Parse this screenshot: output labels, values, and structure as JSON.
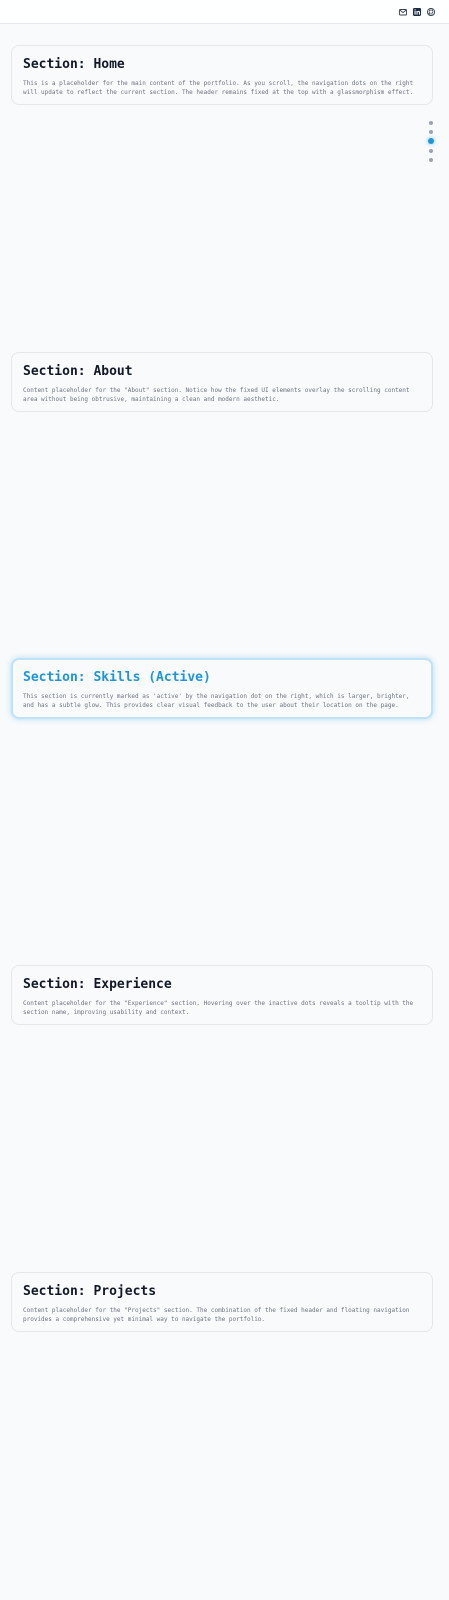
{
  "header": {
    "icons": [
      "mail-icon",
      "linkedin-icon",
      "github-icon"
    ]
  },
  "sections": [
    {
      "title": "Section: Home",
      "body": "This is a placeholder for the main content of the portfolio. As you scroll, the navigation dots on the right will update to reflect the current section. The header remains fixed at the top with a glassmorphism effect."
    },
    {
      "title": "Section: About",
      "body": "Content placeholder for the \"About\" section. Notice how the fixed UI elements overlay the scrolling content area without being obtrusive, maintaining a clean and modern aesthetic."
    },
    {
      "title": "Section: Skills (Active)",
      "body": "This section is currently marked as 'active' by the navigation dot on the right, which is larger, brighter, and has a subtle glow. This provides clear visual feedback to the user about their location on the page."
    },
    {
      "title": "Section: Experience",
      "body": "Content placeholder for the \"Experience\" section. Hovering over the inactive dots reveals a tooltip with the section name, improving usability and context."
    },
    {
      "title": "Section: Projects",
      "body": "Content placeholder for the \"Projects\" section. The combination of the fixed header and floating navigation provides a comprehensive yet minimal way to navigate the portfolio."
    }
  ],
  "nav": {
    "active_index": 2,
    "dot_count": 5
  },
  "colors": {
    "accent": "#1e96d6",
    "background": "#f8fafc",
    "inactive_dot": "#9ca3af",
    "body_text": "#6b7280"
  }
}
